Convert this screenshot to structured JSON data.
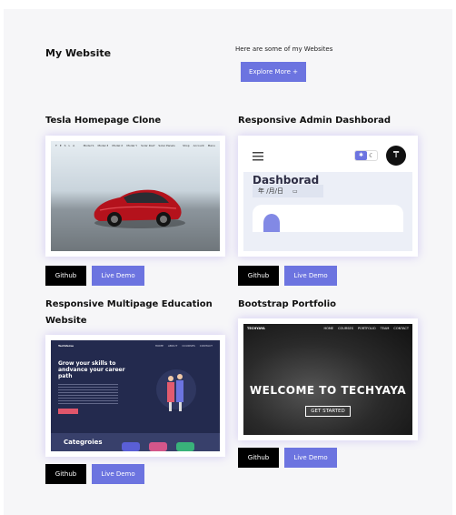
{
  "header": {
    "title": "My Website",
    "intro": "Here are some of my Websites",
    "explore_label": "Explore More +"
  },
  "projects": [
    {
      "title": "Tesla Homepage Clone",
      "github_label": "Github",
      "demo_label": "Live Demo",
      "screenshot": {
        "logo": "T E S L A",
        "nav": [
          "Model S",
          "Model 3",
          "Model X",
          "Model Y",
          "Solar Roof",
          "Solar Panels",
          "Shop",
          "Account",
          "Menu"
        ]
      }
    },
    {
      "title": "Responsive Admin Dashborad",
      "github_label": "Github",
      "demo_label": "Live Demo",
      "screenshot": {
        "heading": "Dashborad",
        "date": "年 /月/日"
      }
    },
    {
      "title": "Responsive Multipage Education Website",
      "github_label": "Github",
      "demo_label": "Live Demo",
      "screenshot": {
        "brand": "TechVerse",
        "nav": [
          "HOME",
          "ABOUT",
          "COURSES",
          "CONTACT"
        ],
        "hero": "Grow your skills to andvance your career path",
        "section": "Categroies"
      }
    },
    {
      "title": "Bootstrap Portfolio",
      "github_label": "Github",
      "demo_label": "Live Demo",
      "screenshot": {
        "brand": "TECHYAYA",
        "nav": [
          "HOME",
          "COURSES",
          "PORTFOLIO",
          "TEAM",
          "CONTACT"
        ],
        "headline": "WELCOME TO TECHYAYA",
        "cta": "GET STARTED"
      }
    }
  ],
  "colors": {
    "accent": "#6c74e0",
    "dark_button": "#000000",
    "page_bg": "#f6f6f8",
    "admin_sun_toggle": "#6c74e0"
  }
}
